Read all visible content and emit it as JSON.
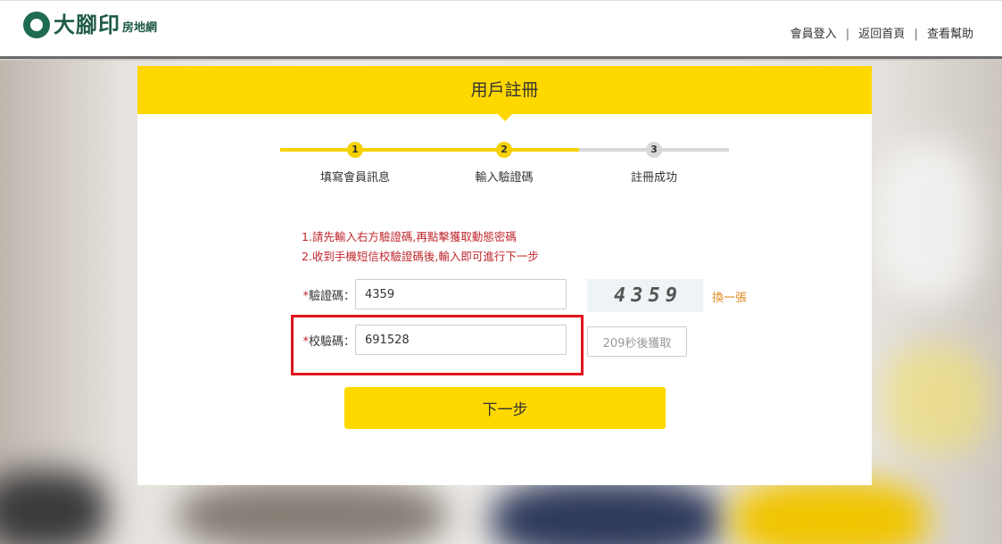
{
  "header": {
    "logo_main": "大腳印",
    "logo_sub": "房地網",
    "nav": [
      "會員登入",
      "返回首頁",
      "查看幫助"
    ],
    "separator": "|"
  },
  "card": {
    "title": "用戶註冊",
    "steps": [
      {
        "num": "1",
        "label": "填寫會員訊息",
        "state": "done"
      },
      {
        "num": "2",
        "label": "輸入驗證碼",
        "state": "active"
      },
      {
        "num": "3",
        "label": "註冊成功",
        "state": "pending"
      }
    ],
    "notes": [
      "1.請先輸入右方驗證碼,再點擊獲取動態密碼",
      "2.收到手機短信校驗證碼後,輸入即可進行下一步"
    ],
    "form": {
      "required_mark": "*",
      "captcha_label": "驗證碼：",
      "captcha_value": "4359",
      "captcha_image_text": "4359",
      "refresh_label": "換一張",
      "code_label": "校驗碼：",
      "code_value": "691528",
      "countdown_label": "209秒後獲取",
      "next_label": "下一步"
    }
  },
  "colors": {
    "accent": "#ffd800",
    "error": "#c0272d",
    "highlight": "#e0141e",
    "link": "#e08a1e"
  }
}
